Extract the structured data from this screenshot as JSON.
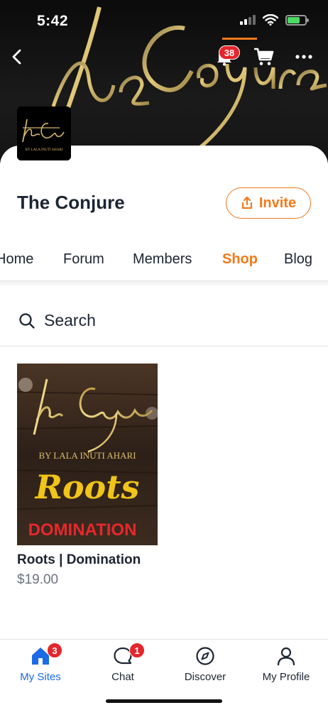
{
  "status_bar": {
    "time": "5:42"
  },
  "header": {
    "notification_count": "38"
  },
  "site": {
    "title": "The Conjure",
    "logo_text": "theConjure",
    "logo_subtext": "BY LALA INUTI AHARI"
  },
  "actions": {
    "invite_label": "Invite"
  },
  "tabs": [
    {
      "label": "Home",
      "active": false
    },
    {
      "label": "Forum",
      "active": false
    },
    {
      "label": "Members",
      "active": false
    },
    {
      "label": "Shop",
      "active": true
    },
    {
      "label": "Blog",
      "active": false
    }
  ],
  "search": {
    "label": "Search"
  },
  "products": [
    {
      "name": "Roots | Domination",
      "price": "$19.00",
      "cover_title": "theConjure",
      "cover_author": "BY LALA INUTI AHARI",
      "cover_subtitle": "Roots",
      "cover_tagline": "DOMINATION"
    }
  ],
  "bottom_nav": [
    {
      "label": "My Sites",
      "badge": "3",
      "icon": "home-icon",
      "active": true
    },
    {
      "label": "Chat",
      "badge": "1",
      "icon": "chat-icon",
      "active": false
    },
    {
      "label": "Discover",
      "badge": "",
      "icon": "compass-icon",
      "active": false
    },
    {
      "label": "My Profile",
      "badge": "",
      "icon": "profile-icon",
      "active": false
    }
  ],
  "colors": {
    "accent": "#f27a1a",
    "active_nav": "#1d6ae5",
    "badge": "#e5262b",
    "text": "#1c2533",
    "gold": "#c9a44c"
  }
}
